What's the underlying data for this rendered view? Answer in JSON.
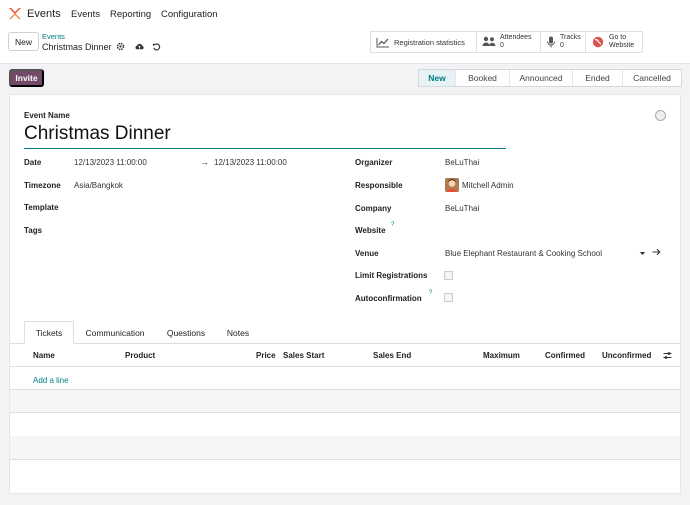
{
  "nav": {
    "app_name": "Events",
    "items": [
      "Events",
      "Reporting",
      "Configuration"
    ],
    "logo_color": "#e8522f"
  },
  "control": {
    "new_label": "New",
    "breadcrumb_parent": "Events",
    "breadcrumb_current": "Christmas Dinner",
    "icons": [
      "gear-icon",
      "cloud-upload-icon",
      "undo-icon"
    ]
  },
  "smart_buttons": {
    "registration": "Registration statistics",
    "attendees_label": "Attendees",
    "attendees_count": "0",
    "tracks_label": "Tracks",
    "tracks_count": "0",
    "website_line1": "Go to",
    "website_line2": "Website"
  },
  "actions": {
    "invite_label": "Invite"
  },
  "stages": [
    "New",
    "Booked",
    "Announced",
    "Ended",
    "Cancelled"
  ],
  "active_stage": "New",
  "form": {
    "event_name_label": "Event Name",
    "event_name": "Christmas Dinner",
    "date_label": "Date",
    "date_start": "12/13/2023 11:00:00",
    "date_arrow": "→",
    "date_end": "12/13/2023 11:00:00",
    "timezone_label": "Timezone",
    "timezone": "Asia/Bangkok",
    "template_label": "Template",
    "tags_label": "Tags",
    "organizer_label": "Organizer",
    "organizer": "BeLuThai",
    "responsible_label": "Responsible",
    "responsible": "Mitchell Admin",
    "company_label": "Company",
    "company": "BeLuThai",
    "website_label": "Website",
    "website_help": "?",
    "venue_label": "Venue",
    "venue": "Blue Elephant Restaurant & Cooking School",
    "limit_label": "Limit Registrations",
    "limit_checked": false,
    "autoconfirm_label": "Autoconfirmation",
    "autoconfirm_help": "?",
    "autoconfirm_checked": false
  },
  "tabs": [
    "Tickets",
    "Communication",
    "Questions",
    "Notes"
  ],
  "active_tab": "Tickets",
  "table": {
    "columns": [
      "Name",
      "Product",
      "Price",
      "Sales Start",
      "Sales End",
      "Maximum",
      "Confirmed",
      "Unconfirmed"
    ],
    "add_line": "Add a line"
  },
  "colors": {
    "accent": "#017e84",
    "primary": "#714b67"
  }
}
